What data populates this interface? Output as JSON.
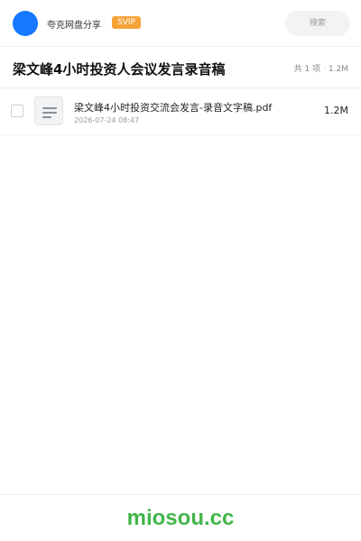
{
  "header": {
    "brand": "夸克网盘分享",
    "badge": "SVIP",
    "search_placeholder": "搜索",
    "avatar_color": "#1677ff",
    "badge_color": "#f7a33a"
  },
  "share": {
    "title": "梁文峰4小时投资人会议发言录音稿",
    "count_text": "共 1 项",
    "total_size": "1.2M"
  },
  "files": [
    {
      "name": "梁文峰4小时投资交流会发言-录音文字稿.pdf",
      "date": "2026-07-24 08:47",
      "size": "1.2M",
      "icon": "document-icon"
    }
  ],
  "footer": {
    "logo": "miosou.cc",
    "logo_color": "#43b54b"
  }
}
